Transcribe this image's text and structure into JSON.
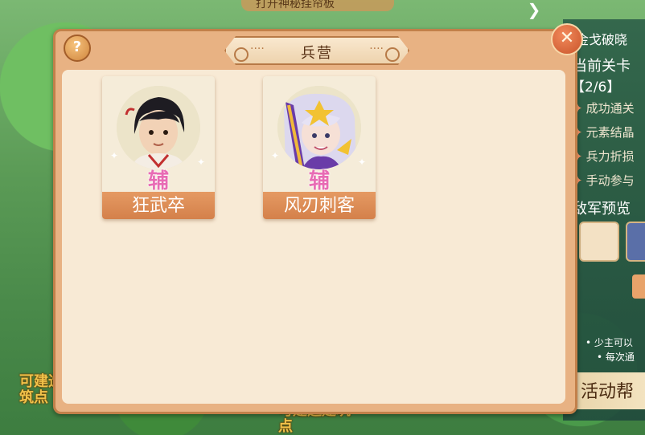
{
  "background": {
    "top_banner_text": "打开神秘挂帘板",
    "side_title": "金戈破晓",
    "current_level_label": "当前关卡",
    "current_level_value": "【2/6】",
    "objectives": [
      "成功通关",
      "元素结晶",
      "兵力折损",
      "手动参与"
    ],
    "enemy_preview_label": "敌军预览",
    "hint_lines": [
      "• 少主可以",
      "• 每次通"
    ],
    "left_label": "可建造建筑点",
    "center_label": "可建造建筑点",
    "help_text": "活动帮"
  },
  "modal": {
    "title": "兵营",
    "help_glyph": "?",
    "close_glyph": "✕"
  },
  "cards": [
    {
      "name": "狂武卒",
      "role": "辅"
    },
    {
      "name": "风刃刺客",
      "role": "辅"
    }
  ],
  "colors": {
    "accent": "#d4804a",
    "panel": "#f8ead5",
    "role_text": "#e86bb4"
  },
  "icons": {
    "help": "help-icon",
    "close": "close-icon",
    "next_arrow": "chevron-right-icon"
  }
}
